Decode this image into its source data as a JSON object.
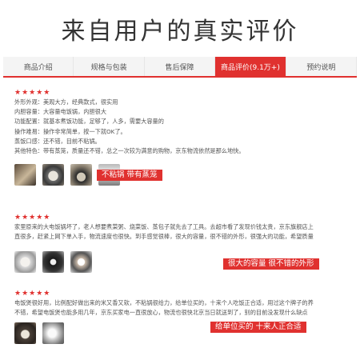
{
  "header": {
    "title": "来自用户的真实评价"
  },
  "tabs": [
    {
      "label": "商品介绍"
    },
    {
      "label": "规格与包装"
    },
    {
      "label": "售后保障"
    },
    {
      "label": "商品评价(9.1万+)"
    },
    {
      "label": "预约说明"
    }
  ],
  "reviews": [
    {
      "stars": "★★★★★",
      "lines": [
        "外形外观：美观大方，经典款式，很实用",
        "内胆容量：大容量电饭锅，内胆很大",
        "功能配置：就基本煮饭功能，足够了，人多，需要大容量的",
        "操作难易：操作非常简单，按一下就OK了。",
        "蒸饭口感：还不错，目前不粘锅。",
        "其他特色：带有蒸笼，质量还不错，总之一次较为满意的购物，京东物流依然是那么地快。"
      ],
      "callout": "不粘锅  带有蒸笼"
    },
    {
      "stars": "★★★★★",
      "lines": [
        "家里原来的大电饭锅坏了，老人想要煮菜粥、烧菜饭、蒸包子就先去了工具。去超市看了发现价钱太贵，京东旗舰店上",
        "直很多，赶紧上网下单入手，物流速度也很快。到手感觉很棒，很大的容量，很不错的外形，很强大的功能，希望质量"
      ],
      "callout": "很大的容量  很不错的外形"
    },
    {
      "stars": "★★★★★",
      "lines": [
        "电饭煲很好用，比例配好做出来的米又香又软，不粘锅很给力，给单位买的，十来个人吃饭正合适，用过这个牌子的养",
        "不错，希望电饭煲也能多用几年，京东买家电一直很放心，物流也很快北京当日就送到了，别的目前没发现什么缺点"
      ],
      "callout": "给单位买的  十来人正合适"
    }
  ]
}
